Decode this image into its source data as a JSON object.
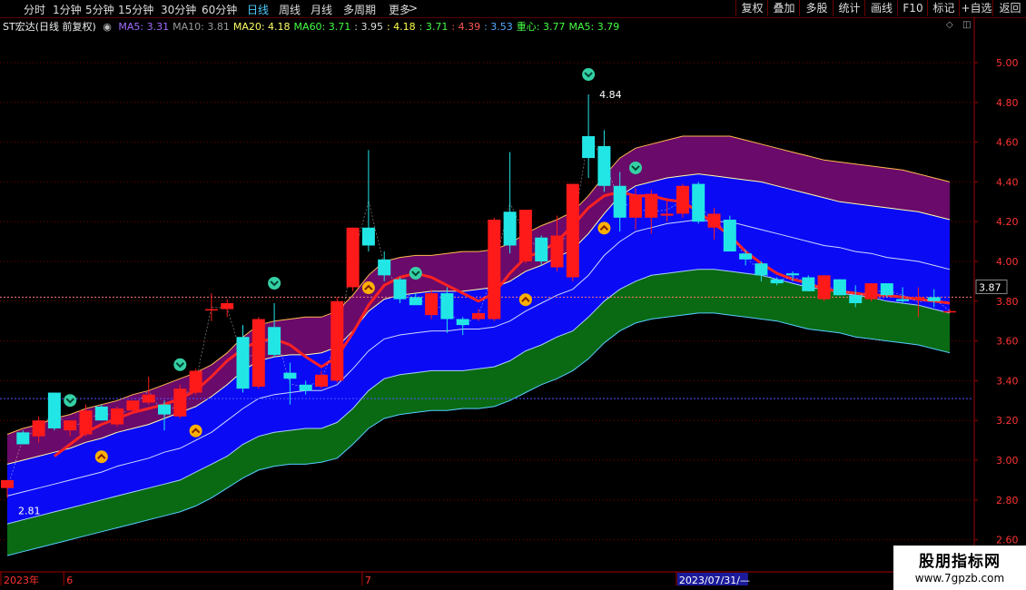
{
  "toolbar": {
    "periods": [
      "分时",
      "1分钟",
      "5分钟",
      "15分钟",
      "30分钟",
      "60分钟",
      "日线",
      "周线",
      "月线",
      "多周期",
      "更多"
    ],
    "active_period": "日线",
    "right_buttons": [
      "复权",
      "叠加",
      "多股",
      "统计",
      "画线",
      "F10",
      "标记",
      "+自选",
      "返回"
    ]
  },
  "legend": {
    "title": "ST宏达(日线 前复权)",
    "items": [
      {
        "text": "MA5: 3.31",
        "color": "#a26bff"
      },
      {
        "text": "MA10: 3.81",
        "color": "#9a9a9a"
      },
      {
        "text": "MA20: 4.18",
        "color": "#ffff66"
      },
      {
        "text": "MA60: 3.71",
        "color": "#44ff44"
      },
      {
        "text": ": 3.95",
        "color": "#dddddd"
      },
      {
        "text": ": 4.18",
        "color": "#ffff44"
      },
      {
        "text": ": 3.71",
        "color": "#44ff44"
      },
      {
        "text": ": 4.39",
        "color": "#ff5555"
      },
      {
        "text": ": 3.53",
        "color": "#55aaff"
      },
      {
        "text": "重心: 3.77",
        "color": "#44ff44"
      },
      {
        "text": "MA5: 3.79",
        "color": "#44ff44"
      }
    ]
  },
  "colors": {
    "up": "#ff1a1a",
    "down": "#22e6e6",
    "band_purple": "#6a0a6a",
    "band_blue": "#0a0af5",
    "band_green": "#0a6a14",
    "axis_text": "#ff3333",
    "midline": "#ff2222"
  },
  "chart_data": {
    "type": "candlestick",
    "ylim": [
      2.55,
      5.1
    ],
    "yticks": [
      5.0,
      4.8,
      4.6,
      4.4,
      4.2,
      4.0,
      3.8,
      3.6,
      3.4,
      3.2,
      3.0,
      2.8,
      2.6
    ],
    "grid": true,
    "current_price": 3.87,
    "high_label": "4.84",
    "low_label": "2.81",
    "x_labels": [
      {
        "index": 0,
        "text": "2023年"
      },
      {
        "index": 4,
        "text": "6"
      },
      {
        "index": 23,
        "text": "7"
      },
      {
        "index": 43,
        "text": "2023/07/31/—"
      }
    ],
    "candles": [
      {
        "o": 2.86,
        "h": 2.9,
        "l": 2.81,
        "c": 2.9
      },
      {
        "o": 3.14,
        "h": 3.15,
        "l": 3.08,
        "c": 3.08
      },
      {
        "o": 3.12,
        "h": 3.22,
        "l": 3.09,
        "c": 3.2
      },
      {
        "o": 3.34,
        "h": 3.34,
        "l": 3.15,
        "c": 3.16
      },
      {
        "o": 3.15,
        "h": 3.2,
        "l": 3.12,
        "c": 3.2
      },
      {
        "o": 3.13,
        "h": 3.28,
        "l": 3.12,
        "c": 3.25
      },
      {
        "o": 3.27,
        "h": 3.28,
        "l": 3.2,
        "c": 3.2
      },
      {
        "o": 3.18,
        "h": 3.27,
        "l": 3.17,
        "c": 3.26
      },
      {
        "o": 3.25,
        "h": 3.3,
        "l": 3.24,
        "c": 3.3
      },
      {
        "o": 3.29,
        "h": 3.42,
        "l": 3.28,
        "c": 3.33
      },
      {
        "o": 3.28,
        "h": 3.3,
        "l": 3.15,
        "c": 3.23
      },
      {
        "o": 3.22,
        "h": 3.38,
        "l": 3.21,
        "c": 3.36
      },
      {
        "o": 3.34,
        "h": 3.46,
        "l": 3.33,
        "c": 3.45
      },
      {
        "o": 3.76,
        "h": 3.84,
        "l": 3.7,
        "c": 3.76
      },
      {
        "o": 3.76,
        "h": 3.81,
        "l": 3.72,
        "c": 3.79
      },
      {
        "o": 3.62,
        "h": 3.68,
        "l": 3.34,
        "c": 3.36
      },
      {
        "o": 3.37,
        "h": 3.72,
        "l": 3.36,
        "c": 3.71
      },
      {
        "o": 3.67,
        "h": 3.79,
        "l": 3.52,
        "c": 3.53
      },
      {
        "o": 3.44,
        "h": 3.49,
        "l": 3.28,
        "c": 3.41
      },
      {
        "o": 3.38,
        "h": 3.4,
        "l": 3.33,
        "c": 3.35
      },
      {
        "o": 3.37,
        "h": 3.45,
        "l": 3.36,
        "c": 3.43
      },
      {
        "o": 3.4,
        "h": 3.82,
        "l": 3.39,
        "c": 3.8
      },
      {
        "o": 3.87,
        "h": 4.17,
        "l": 3.85,
        "c": 4.17
      },
      {
        "o": 4.17,
        "h": 4.56,
        "l": 4.05,
        "c": 4.08
      },
      {
        "o": 4.01,
        "h": 4.05,
        "l": 3.9,
        "c": 3.93
      },
      {
        "o": 3.91,
        "h": 3.92,
        "l": 3.79,
        "c": 3.81
      },
      {
        "o": 3.82,
        "h": 3.84,
        "l": 3.78,
        "c": 3.78
      },
      {
        "o": 3.73,
        "h": 3.86,
        "l": 3.71,
        "c": 3.84
      },
      {
        "o": 3.84,
        "h": 3.87,
        "l": 3.64,
        "c": 3.71
      },
      {
        "o": 3.71,
        "h": 3.72,
        "l": 3.63,
        "c": 3.68
      },
      {
        "o": 3.71,
        "h": 3.76,
        "l": 3.7,
        "c": 3.74
      },
      {
        "o": 3.71,
        "h": 4.22,
        "l": 3.7,
        "c": 4.21
      },
      {
        "o": 4.25,
        "h": 4.55,
        "l": 4.04,
        "c": 4.08
      },
      {
        "o": 4.0,
        "h": 4.26,
        "l": 3.99,
        "c": 4.26
      },
      {
        "o": 4.12,
        "h": 4.13,
        "l": 3.98,
        "c": 4.0
      },
      {
        "o": 3.97,
        "h": 4.23,
        "l": 3.95,
        "c": 4.13
      },
      {
        "o": 3.92,
        "h": 4.39,
        "l": 3.9,
        "c": 4.39
      },
      {
        "o": 4.63,
        "h": 4.84,
        "l": 4.42,
        "c": 4.52
      },
      {
        "o": 4.58,
        "h": 4.66,
        "l": 4.35,
        "c": 4.38
      },
      {
        "o": 4.38,
        "h": 4.45,
        "l": 4.15,
        "c": 4.22
      },
      {
        "o": 4.22,
        "h": 4.37,
        "l": 4.16,
        "c": 4.33
      },
      {
        "o": 4.22,
        "h": 4.36,
        "l": 4.14,
        "c": 4.34
      },
      {
        "o": 4.23,
        "h": 4.32,
        "l": 4.2,
        "c": 4.24
      },
      {
        "o": 4.24,
        "h": 4.39,
        "l": 4.22,
        "c": 4.38
      },
      {
        "o": 4.39,
        "h": 4.4,
        "l": 4.19,
        "c": 4.2
      },
      {
        "o": 4.17,
        "h": 4.27,
        "l": 4.11,
        "c": 4.24
      },
      {
        "o": 4.21,
        "h": 4.23,
        "l": 4.08,
        "c": 4.05
      },
      {
        "o": 4.04,
        "h": 4.06,
        "l": 3.98,
        "c": 4.01
      },
      {
        "o": 3.99,
        "h": 4.0,
        "l": 3.9,
        "c": 3.93
      },
      {
        "o": 3.91,
        "h": 3.92,
        "l": 3.88,
        "c": 3.89
      },
      {
        "o": 3.94,
        "h": 3.95,
        "l": 3.9,
        "c": 3.93
      },
      {
        "o": 3.92,
        "h": 3.93,
        "l": 3.85,
        "c": 3.85
      },
      {
        "o": 3.81,
        "h": 3.93,
        "l": 3.8,
        "c": 3.93
      },
      {
        "o": 3.91,
        "h": 3.91,
        "l": 3.83,
        "c": 3.83
      },
      {
        "o": 3.83,
        "h": 3.88,
        "l": 3.77,
        "c": 3.79
      },
      {
        "o": 3.81,
        "h": 3.89,
        "l": 3.8,
        "c": 3.89
      },
      {
        "o": 3.89,
        "h": 3.89,
        "l": 3.82,
        "c": 3.83
      },
      {
        "o": 3.81,
        "h": 3.87,
        "l": 3.79,
        "c": 3.8
      },
      {
        "o": 3.82,
        "h": 3.87,
        "l": 3.72,
        "c": 3.82
      },
      {
        "o": 3.82,
        "h": 3.86,
        "l": 3.77,
        "c": 3.8
      },
      {
        "o": 3.75,
        "h": 3.76,
        "l": 3.74,
        "c": 3.75
      }
    ],
    "bands": {
      "b1": [
        3.13,
        3.16,
        3.18,
        3.21,
        3.23,
        3.26,
        3.28,
        3.3,
        3.33,
        3.35,
        3.38,
        3.41,
        3.44,
        3.48,
        3.54,
        3.62,
        3.68,
        3.7,
        3.71,
        3.72,
        3.72,
        3.75,
        3.83,
        3.93,
        4.0,
        4.02,
        4.03,
        4.03,
        4.04,
        4.05,
        4.05,
        4.06,
        4.09,
        4.14,
        4.18,
        4.21,
        4.25,
        4.33,
        4.43,
        4.52,
        4.57,
        4.59,
        4.61,
        4.63,
        4.63,
        4.63,
        4.63,
        4.61,
        4.59,
        4.57,
        4.55,
        4.53,
        4.51,
        4.5,
        4.49,
        4.48,
        4.47,
        4.46,
        4.44,
        4.42,
        4.4
      ],
      "b2": [
        2.98,
        3.0,
        3.02,
        3.04,
        3.06,
        3.09,
        3.11,
        3.14,
        3.16,
        3.18,
        3.21,
        3.24,
        3.27,
        3.32,
        3.38,
        3.45,
        3.5,
        3.52,
        3.53,
        3.53,
        3.54,
        3.57,
        3.65,
        3.75,
        3.81,
        3.83,
        3.84,
        3.85,
        3.85,
        3.85,
        3.86,
        3.87,
        3.9,
        3.95,
        3.98,
        4.02,
        4.06,
        4.14,
        4.24,
        4.33,
        4.38,
        4.4,
        4.42,
        4.43,
        4.44,
        4.43,
        4.42,
        4.41,
        4.4,
        4.38,
        4.36,
        4.34,
        4.32,
        4.3,
        4.29,
        4.28,
        4.27,
        4.26,
        4.25,
        4.23,
        4.21
      ],
      "b3": [
        2.82,
        2.84,
        2.86,
        2.88,
        2.9,
        2.92,
        2.94,
        2.97,
        2.99,
        3.01,
        3.04,
        3.06,
        3.1,
        3.14,
        3.2,
        3.26,
        3.31,
        3.33,
        3.34,
        3.35,
        3.35,
        3.38,
        3.46,
        3.55,
        3.61,
        3.63,
        3.64,
        3.65,
        3.65,
        3.66,
        3.66,
        3.67,
        3.7,
        3.75,
        3.79,
        3.83,
        3.86,
        3.93,
        4.03,
        4.1,
        4.15,
        4.17,
        4.19,
        4.2,
        4.21,
        4.2,
        4.2,
        4.18,
        4.16,
        4.14,
        4.12,
        4.1,
        4.08,
        4.07,
        4.05,
        4.04,
        4.02,
        4.01,
        4.0,
        3.98,
        3.96
      ],
      "b4": [
        2.68,
        2.7,
        2.72,
        2.74,
        2.76,
        2.78,
        2.8,
        2.82,
        2.84,
        2.86,
        2.88,
        2.9,
        2.94,
        2.98,
        3.02,
        3.08,
        3.12,
        3.14,
        3.15,
        3.16,
        3.16,
        3.19,
        3.26,
        3.35,
        3.41,
        3.43,
        3.44,
        3.45,
        3.45,
        3.45,
        3.46,
        3.47,
        3.5,
        3.55,
        3.58,
        3.62,
        3.65,
        3.72,
        3.8,
        3.86,
        3.9,
        3.93,
        3.94,
        3.95,
        3.96,
        3.96,
        3.95,
        3.94,
        3.93,
        3.91,
        3.89,
        3.87,
        3.86,
        3.84,
        3.83,
        3.82,
        3.8,
        3.79,
        3.78,
        3.76,
        3.74
      ],
      "b5": [
        2.52,
        2.54,
        2.56,
        2.58,
        2.6,
        2.62,
        2.64,
        2.66,
        2.68,
        2.7,
        2.72,
        2.74,
        2.77,
        2.81,
        2.86,
        2.91,
        2.95,
        2.97,
        2.98,
        2.98,
        2.99,
        3.01,
        3.08,
        3.16,
        3.21,
        3.23,
        3.24,
        3.25,
        3.25,
        3.26,
        3.26,
        3.27,
        3.3,
        3.34,
        3.38,
        3.41,
        3.45,
        3.51,
        3.59,
        3.65,
        3.69,
        3.71,
        3.72,
        3.73,
        3.74,
        3.74,
        3.73,
        3.72,
        3.71,
        3.7,
        3.68,
        3.66,
        3.65,
        3.64,
        3.62,
        3.61,
        3.6,
        3.59,
        3.58,
        3.56,
        3.54
      ]
    },
    "ma_line": [
      null,
      null,
      null,
      3.02,
      3.08,
      3.14,
      3.18,
      3.21,
      3.24,
      3.26,
      3.28,
      3.31,
      3.35,
      3.42,
      3.5,
      3.56,
      3.6,
      3.61,
      3.58,
      3.52,
      3.47,
      3.52,
      3.64,
      3.78,
      3.88,
      3.92,
      3.94,
      3.92,
      3.88,
      3.84,
      3.8,
      3.84,
      3.94,
      4.02,
      4.05,
      4.1,
      4.18,
      4.27,
      4.33,
      4.35,
      4.33,
      4.33,
      4.31,
      4.3,
      4.25,
      4.19,
      4.13,
      4.05,
      3.99,
      3.94,
      3.91,
      3.89,
      3.86,
      3.85,
      3.84,
      3.83,
      3.83,
      3.82,
      3.81,
      3.8,
      3.79
    ],
    "buy_signals": [
      6,
      12,
      23,
      33,
      38
    ],
    "sell_signals": [
      4,
      11,
      17,
      26,
      37,
      40
    ],
    "dashed_levels": [
      3.82,
      3.31
    ]
  }
}
